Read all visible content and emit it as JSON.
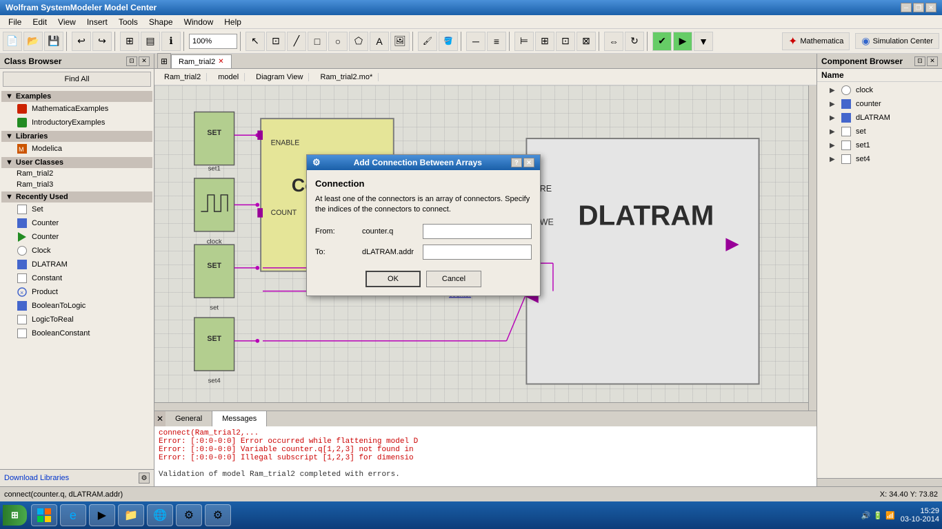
{
  "app": {
    "title": "Wolfram SystemModeler Model Center",
    "window_controls": [
      "minimize",
      "restore",
      "close"
    ]
  },
  "menu": {
    "items": [
      "File",
      "Edit",
      "View",
      "Insert",
      "Tools",
      "Shape",
      "Window",
      "Help"
    ]
  },
  "toolbar": {
    "zoom": "100%",
    "mathematica_label": "Mathematica",
    "simulation_label": "Simulation Center"
  },
  "left_panel": {
    "title": "Class Browser",
    "find_all_label": "Find All",
    "examples_group": "Examples",
    "libraries_group": "Libraries",
    "user_classes_group": "User Classes",
    "recently_used_group": "Recently Used",
    "examples_items": [
      "MathematicaExamples",
      "IntroductoryExamples"
    ],
    "libraries_items": [
      "Modelica"
    ],
    "user_classes_items": [
      "Ram_trial2",
      "Ram_trial3"
    ],
    "recently_used_items": [
      {
        "label": "Set",
        "icon": "white-sq"
      },
      {
        "label": "Counter",
        "icon": "blue-sq"
      },
      {
        "label": "Counter",
        "icon": "play"
      },
      {
        "label": "Clock",
        "icon": "clock"
      },
      {
        "label": "DLATRAM",
        "icon": "blue-sq"
      },
      {
        "label": "Constant",
        "icon": "white-sq"
      },
      {
        "label": "Product",
        "icon": "product"
      },
      {
        "label": "BooleanToLogic",
        "icon": "blue-sq"
      },
      {
        "label": "LogicToReal",
        "icon": "white-sq"
      },
      {
        "label": "BooleanConstant",
        "icon": "white-sq"
      }
    ],
    "download_label": "Download Libraries"
  },
  "tabs": [
    {
      "label": "Ram_trial2",
      "active": true
    }
  ],
  "diagram_info": {
    "model_name": "Ram_trial2",
    "type": "model",
    "view": "Diagram View",
    "file": "Ram_trial2.mo*"
  },
  "right_panel": {
    "title": "Component Browser",
    "column_name": "Name",
    "items": [
      {
        "label": "clock",
        "icon": "clock"
      },
      {
        "label": "counter",
        "icon": "blue-sq"
      },
      {
        "label": "dLATRAM",
        "icon": "blue-sq"
      },
      {
        "label": "set",
        "icon": "white-sq"
      },
      {
        "label": "set1",
        "icon": "white-sq"
      },
      {
        "label": "set4",
        "icon": "white-sq"
      }
    ]
  },
  "messages_panel": {
    "tabs": [
      "General",
      "Messages"
    ],
    "active_tab": "Messages",
    "lines": [
      "connect(Ram_trial2,...",
      "Error: [:0:0-0:0] Error occurred while flattening model D",
      "Error: [:0:0-0:0] Variable counter.q[1,2,3] not found in",
      "Error: [:0:0-0:0] Illegal subscript [1,2,3] for dimensio",
      "",
      "Validation of model Ram_trial2 completed with errors."
    ]
  },
  "status_bar": {
    "left_text": "connect(counter.q, dLATRAM.addr)",
    "coords": "X: 34.40    Y: 73.82"
  },
  "modal": {
    "title": "Add Connection Between Arrays",
    "help_btn": "?",
    "close_btn": "✕",
    "section_title": "Connection",
    "description": "At least one of the connectors is an array of connectors. Specify the indices of the connectors to connect.",
    "from_label": "From:",
    "from_value": "counter.q",
    "to_label": "To:",
    "to_value": "dLATRAM.addr",
    "ok_label": "OK",
    "cancel_label": "Cancel"
  },
  "taskbar": {
    "time": "15:29",
    "date": "03-10-2014",
    "apps": [
      "⊞",
      "🌐",
      "▶",
      "📁",
      "🌐",
      "⚙",
      "⚙"
    ]
  }
}
